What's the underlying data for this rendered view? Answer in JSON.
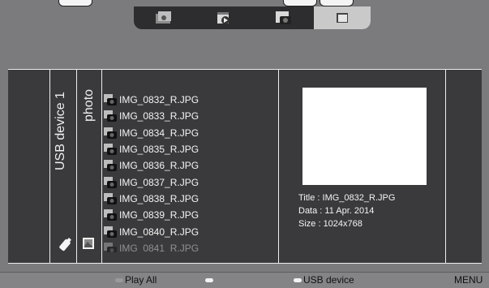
{
  "top_tabs": [
    {
      "name": "music",
      "active": false
    },
    {
      "name": "video",
      "active": false
    },
    {
      "name": "photo",
      "active": false
    },
    {
      "name": "folder",
      "active": true
    }
  ],
  "sidebar": {
    "device": "USB device 1",
    "folder": "photo"
  },
  "files": [
    "IMG_0832_R.JPG",
    "IMG_0833_R.JPG",
    "IMG_0834_R.JPG",
    "IMG_0835_R.JPG",
    "IMG_0836_R.JPG",
    "IMG_0837_R.JPG",
    "IMG_0838_R.JPG",
    "IMG_0839_R.JPG",
    "IMG_0840_R.JPG",
    "IMG_0841_R.JPG"
  ],
  "info": {
    "title": "Title :  IMG_0832_R.JPG",
    "date": "Data :  11 Apr. 2014",
    "size": "Size :  1024x768"
  },
  "bottom": {
    "play_all": "Play All",
    "usb_device": "USB device",
    "menu": "MENU",
    "colors": {
      "red": "#9a9a9c",
      "green": "#f2f2f2",
      "yellow": "#f2f2f2"
    }
  }
}
